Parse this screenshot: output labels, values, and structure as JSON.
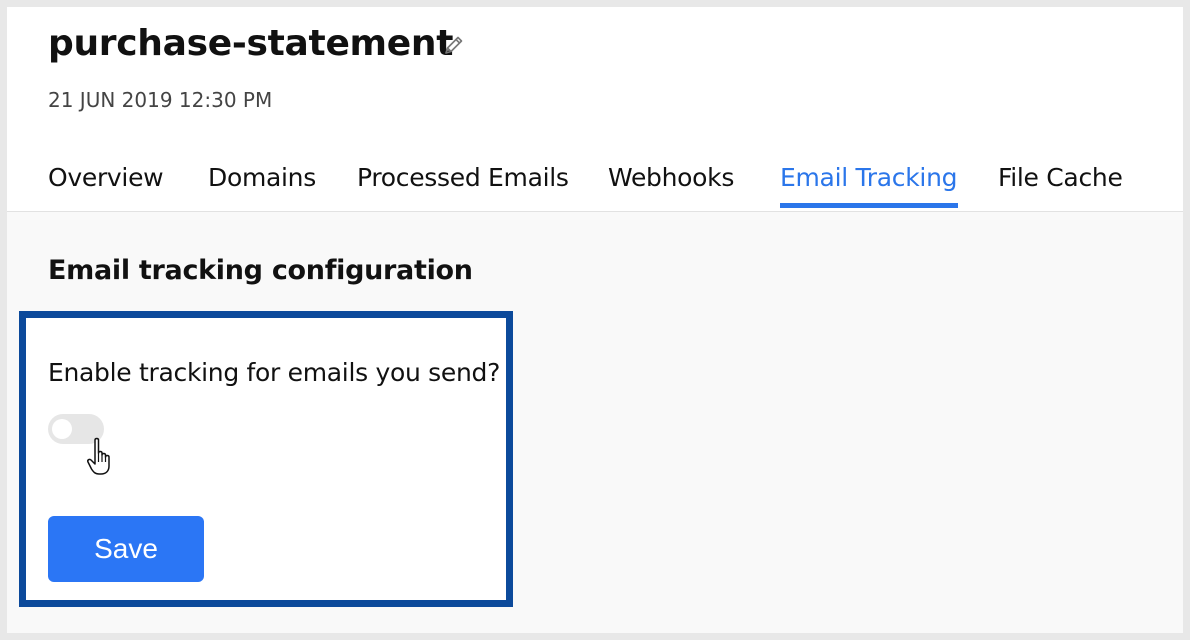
{
  "header": {
    "title": "purchase-statement",
    "timestamp": "21 JUN 2019 12:30 PM",
    "edit_icon": "pencil-icon"
  },
  "tabs": [
    {
      "label": "Overview",
      "active": false
    },
    {
      "label": "Domains",
      "active": false
    },
    {
      "label": "Processed Emails",
      "active": false
    },
    {
      "label": "Webhooks",
      "active": false
    },
    {
      "label": "Email Tracking",
      "active": true
    },
    {
      "label": "File Cache",
      "active": false
    }
  ],
  "main": {
    "section_title": "Email tracking configuration",
    "question": "Enable tracking for emails you send?",
    "tracking_enabled": false,
    "save_label": "Save"
  },
  "colors": {
    "accent": "#2b76ea",
    "highlight_border": "#0c4a9b",
    "button": "#2b76f5",
    "toggle_off": "#e6e6e6"
  }
}
